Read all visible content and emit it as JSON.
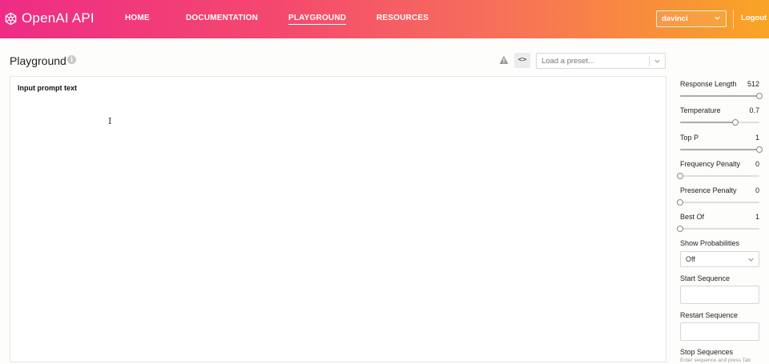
{
  "header": {
    "logo_text": "OpenAI API",
    "nav": [
      "HOME",
      "DOCUMENTATION",
      "PLAYGROUND",
      "RESOURCES"
    ],
    "active_nav": "PLAYGROUND",
    "engine": "davinci",
    "logout": "Logout",
    "gradient_colors": [
      "#ee2c86",
      "#f7705a",
      "#f9a524"
    ]
  },
  "toolbar": {
    "title": "Playground",
    "info_icon": "i",
    "code_button": "<>",
    "preset_placeholder": "Load a preset..."
  },
  "prompt": {
    "text": "Input prompt text"
  },
  "settings": {
    "response_length": {
      "label": "Response Length",
      "value": "512",
      "fraction": 1.0
    },
    "temperature": {
      "label": "Temperature",
      "value": "0.7",
      "fraction": 0.7
    },
    "top_p": {
      "label": "Top P",
      "value": "1",
      "fraction": 1.0
    },
    "frequency_penalty": {
      "label": "Frequency Penalty",
      "value": "0",
      "fraction": 0.0
    },
    "presence_penalty": {
      "label": "Presence Penalty",
      "value": "0",
      "fraction": 0.0
    },
    "best_of": {
      "label": "Best Of",
      "value": "1",
      "fraction": 0.0
    },
    "show_probabilities": {
      "label": "Show Probabilities",
      "value": "Off"
    },
    "start_sequence": {
      "label": "Start Sequence",
      "value": ""
    },
    "restart_sequence": {
      "label": "Restart Sequence",
      "value": ""
    },
    "stop_sequences": {
      "label": "Stop Sequences",
      "hint": "Enter sequence and press Tab"
    }
  }
}
